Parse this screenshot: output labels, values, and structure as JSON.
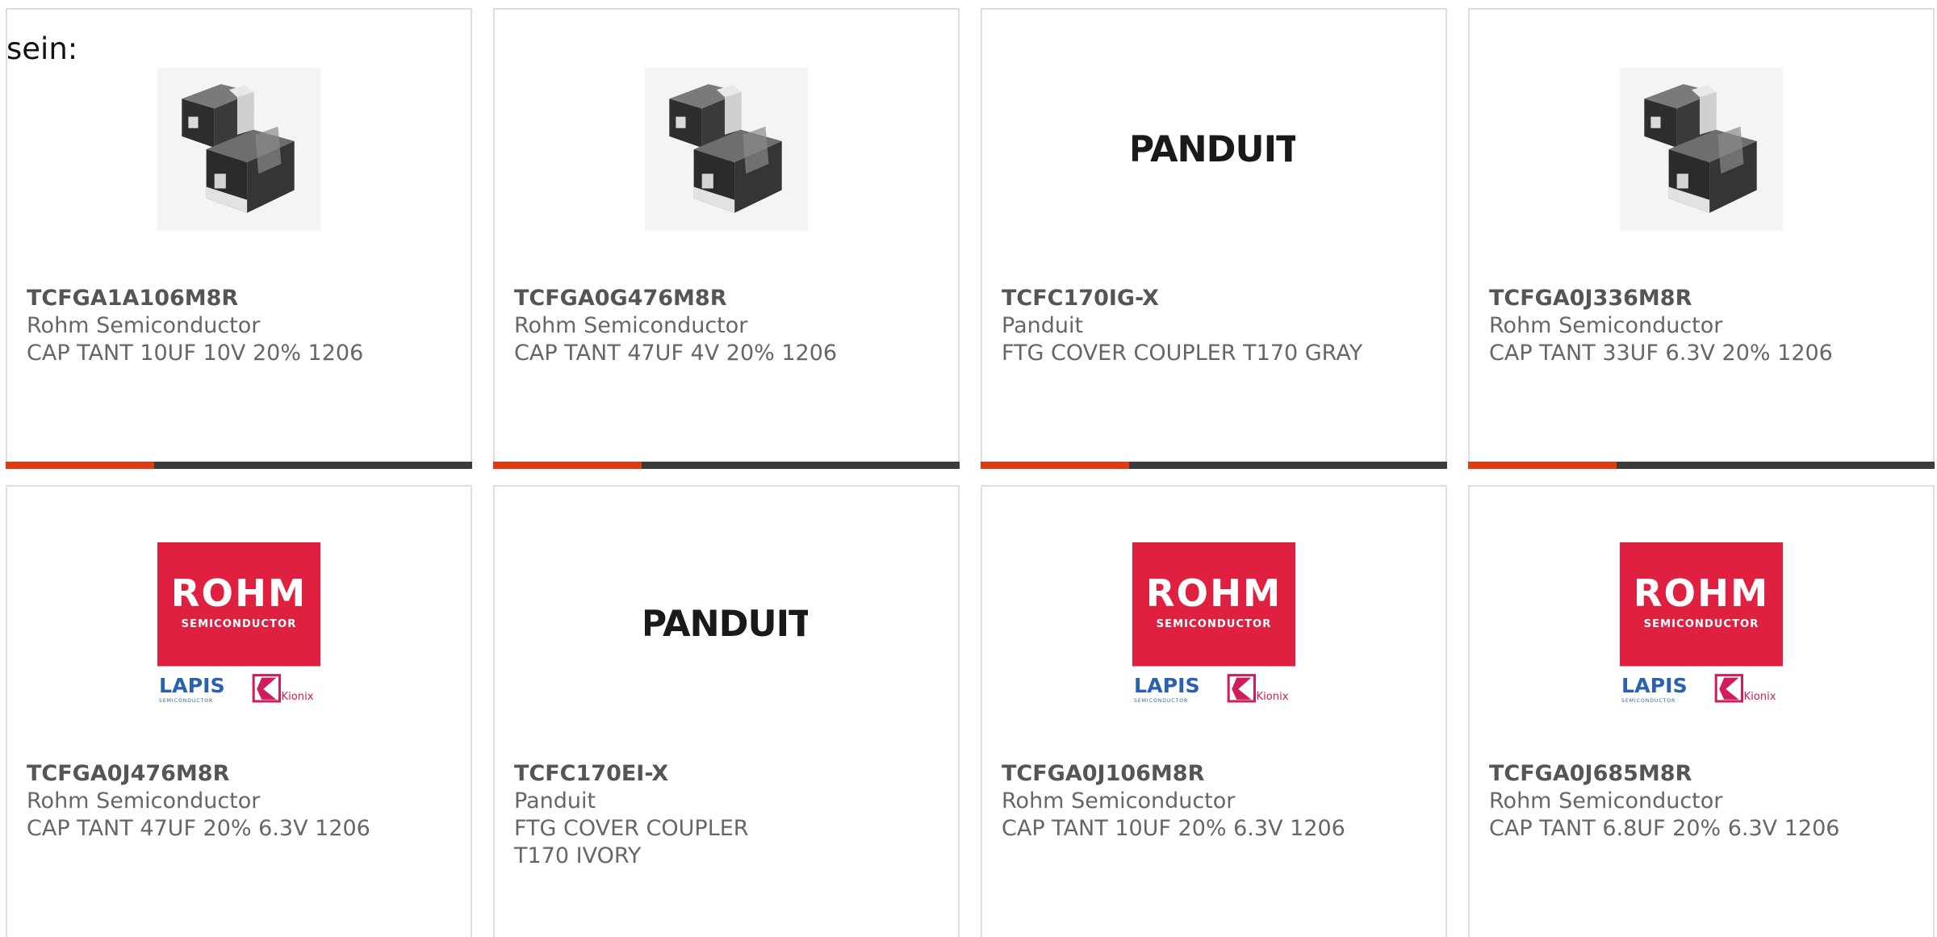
{
  "intro_text": "sein:",
  "colors": {
    "accent_bar": "#dd3d12",
    "dark_bar": "#3c3c3c",
    "rohm_red": "#e02040",
    "lapis_blue": "#2a62b0",
    "kionix_pink": "#d11c5c"
  },
  "products": [
    {
      "part_number": "TCFGA1A106M8R",
      "manufacturer": "Rohm Semiconductor",
      "description": "CAP TANT 10UF 10V 20% 1206",
      "image": "tantalum-capacitor-photo"
    },
    {
      "part_number": "TCFGA0G476M8R",
      "manufacturer": "Rohm Semiconductor",
      "description": "CAP TANT 47UF 4V 20% 1206",
      "image": "tantalum-capacitor-photo"
    },
    {
      "part_number": "TCFC170IG-X",
      "manufacturer": "Panduit",
      "description": "FTG COVER COUPLER T170 GRAY",
      "image": "panduit-logo",
      "logo_text": "PANDUIT"
    },
    {
      "part_number": "TCFGA0J336M8R",
      "manufacturer": "Rohm Semiconductor",
      "description": "CAP TANT 33UF 6.3V 20% 1206",
      "image": "tantalum-capacitor-photo"
    },
    {
      "part_number": "TCFGA0J476M8R",
      "manufacturer": "Rohm Semiconductor",
      "description": "CAP TANT 47UF 20% 6.3V 1206",
      "image": "rohm-lapis-kionix-logo",
      "logo_text": {
        "rohm": "ROHM",
        "semi": "SEMICONDUCTOR",
        "lapis": "LAPIS",
        "lapis_sub": "SEMICONDUCTOR",
        "kionix": "Kionix"
      }
    },
    {
      "part_number": "TCFC170EI-X",
      "manufacturer": "Panduit",
      "description": "FTG COVER COUPLER T170 IVORY",
      "image": "panduit-logo",
      "logo_text": "PANDUIT"
    },
    {
      "part_number": "TCFGA0J106M8R",
      "manufacturer": "Rohm Semiconductor",
      "description": "CAP TANT 10UF 20% 6.3V 1206",
      "image": "rohm-lapis-kionix-logo",
      "logo_text": {
        "rohm": "ROHM",
        "semi": "SEMICONDUCTOR",
        "lapis": "LAPIS",
        "lapis_sub": "SEMICONDUCTOR",
        "kionix": "Kionix"
      }
    },
    {
      "part_number": "TCFGA0J685M8R",
      "manufacturer": "Rohm Semiconductor",
      "description": "CAP TANT 6.8UF 20% 6.3V 1206",
      "image": "rohm-lapis-kionix-logo",
      "logo_text": {
        "rohm": "ROHM",
        "semi": "SEMICONDUCTOR",
        "lapis": "LAPIS",
        "lapis_sub": "SEMICONDUCTOR",
        "kionix": "Kionix"
      }
    }
  ]
}
